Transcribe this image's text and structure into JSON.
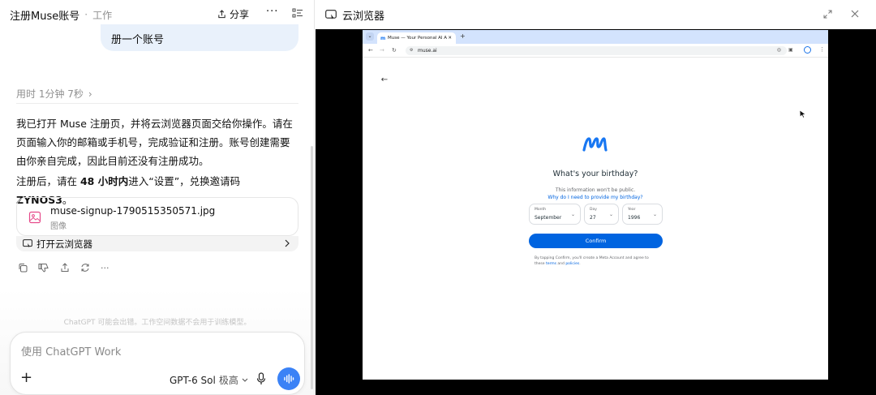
{
  "header": {
    "title": "注册Muse账号",
    "separator": "·",
    "subtitle": "工作",
    "share_label": "分享",
    "more_label": "···"
  },
  "chat": {
    "user_message": "册一个账号",
    "elapsed": "用时 1分钟 7秒",
    "para1": "我已打开 Muse 注册页，并将云浏览器页面交给你操作。请在页面输入你的邮箱或手机号，完成验证和注册。账号创建需要由你亲自完成，因此目前还没有注册成功。",
    "para2_prefix": "注册后，请在 ",
    "para2_bold1": "48 小时内",
    "para2_mid": "进入“设置”，兑换邀请码 ",
    "para2_bold2": "ZYNOS3",
    "para2_suffix": "。",
    "file": {
      "name": "muse-signup-1790515350571.jpg",
      "type": "图像"
    },
    "open_browser_label": "打开云浏览器",
    "disclaimer": "ChatGPT 可能会出错。工作空间数据不会用于训练模型。"
  },
  "composer": {
    "placeholder": "使用 ChatGPT Work",
    "plus": "+",
    "model": "GPT-6 Sol",
    "level": "极高"
  },
  "cloud_browser": {
    "title": "云浏览器",
    "tab_title": "Muse — Your Personal AI A",
    "url": "muse.ai",
    "page": {
      "heading": "What's your birthday?",
      "note": "This information won't be public.",
      "why_link": "Why do I need to provide my birthday?",
      "month": {
        "label": "Month",
        "value": "September"
      },
      "day": {
        "label": "Day",
        "value": "27"
      },
      "year": {
        "label": "Year",
        "value": "1996"
      },
      "confirm": "Confirm",
      "legal_prefix": "By tapping Confirm, you'll create a Meta Account and agree to these ",
      "legal_terms": "terms",
      "legal_and": " and ",
      "legal_policies": "policies",
      "legal_end": "."
    }
  },
  "colors": {
    "accent": "#3b82f6",
    "bubble": "#e9f1fb",
    "meta_blue": "#0064e0"
  }
}
